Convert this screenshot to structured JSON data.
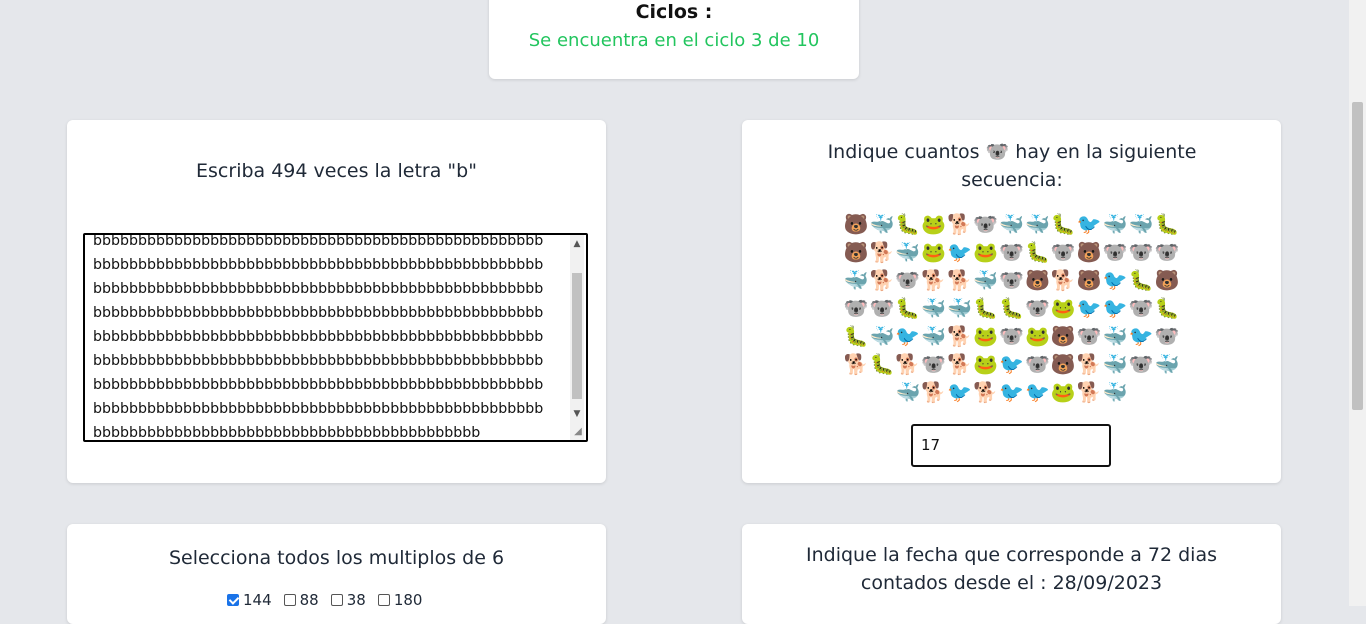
{
  "ciclos": {
    "title": "Ciclos :",
    "status": "Se encuentra en el ciclo 3 de 10"
  },
  "letter_task": {
    "prompt": "Escriba 494 veces la letra \"b\"",
    "lines": [
      "bbbbbbbbbbbbbbbbbbbbbbbbbbbbbbbbbbbbbbbbbbbbbbbbbb",
      "bbbbbbbbbbbbbbbbbbbbbbbbbbbbbbbbbbbbbbbbbbbbbbbbbb",
      "bbbbbbbbbbbbbbbbbbbbbbbbbbbbbbbbbbbbbbbbbbbbbbbbbb",
      "bbbbbbbbbbbbbbbbbbbbbbbbbbbbbbbbbbbbbbbbbbbbbbbbbb",
      "bbbbbbbbbbbbbbbbbbbbbbbbbbbbbbbbbbbbbbbbbbbbbbbbbb",
      "bbbbbbbbbbbbbbbbbbbbbbbbbbbbbbbbbbbbbbbbbbbbbbbbbb",
      "bbbbbbbbbbbbbbbbbbbbbbbbbbbbbbbbbbbbbbbbbbbbbbbbbb",
      "bbbbbbbbbbbbbbbbbbbbbbbbbbbbbbbbbbbbbbbbbbbbbbbbbb",
      "bbbbbbbbbbbbbbbbbbbbbbbbbbbbbbbbbbbbbbbbbbb"
    ]
  },
  "count_task": {
    "prompt": "Indique cuantos 🐨 hay en la siguiente secuencia:",
    "rows": [
      "🐻🐳🐛🐸🐕🐨🐳🐳🐛🐦🐳🐳🐛",
      "🐻🐕🐳🐸🐦🐸🐨🐛🐨🐻🐨🐨🐨",
      "🐳🐕🐨🐕🐕🐳🐨🐻🐕🐻🐦🐛🐻",
      "🐨🐨🐛🐳🐳🐛🐛🐨🐸🐦🐦🐨🐛",
      "🐛🐳🐦🐳🐕🐸🐨🐸🐻🐨🐳🐦🐨",
      "🐕🐛🐕🐨🐕🐸🐦🐨🐻🐕🐳🐨🐳",
      "🐳🐕🐦🐕🐦🐦🐸🐕🐳"
    ],
    "answer": "17"
  },
  "multiples_task": {
    "prompt": "Selecciona todos los multiplos de 6",
    "options": [
      {
        "label": "144",
        "checked": true
      },
      {
        "label": "88",
        "checked": false
      },
      {
        "label": "38",
        "checked": false
      },
      {
        "label": "180",
        "checked": false
      }
    ]
  },
  "date_task": {
    "prompt": "Indique la fecha que corresponde a 72 dias contados desde el : 28/09/2023"
  }
}
